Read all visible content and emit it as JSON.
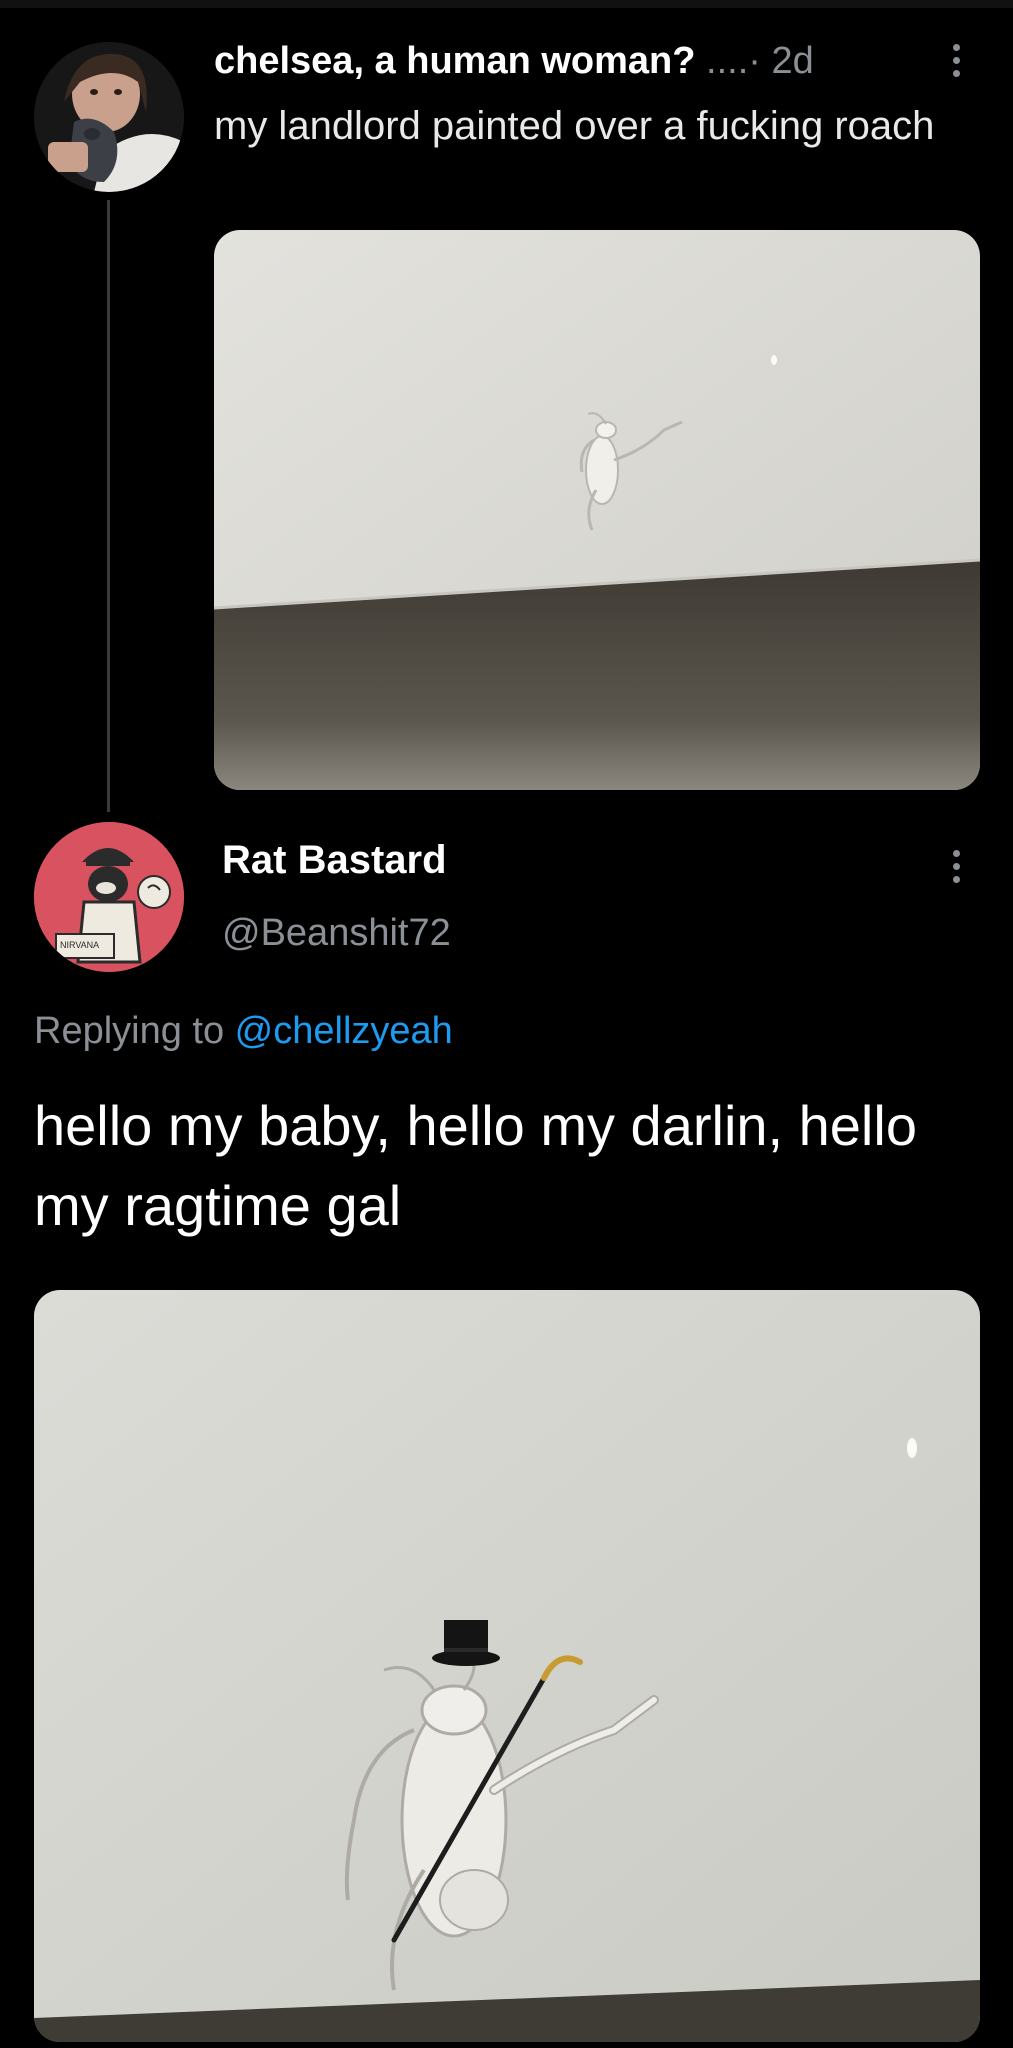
{
  "tweet1": {
    "display_name": "chelsea, a human woman?",
    "meta": " ....· 2d",
    "text": "my landlord painted over a fucking roach",
    "avatar_icon": "avatar-photo-icon",
    "more_icon": "more-options-icon"
  },
  "tweet2": {
    "display_name": "Rat Bastard",
    "handle": "@Beanshit72",
    "replying_prefix": "Replying to ",
    "replying_to": "@chellzyeah",
    "text": "hello my baby, hello my darlin, hello my ragtime gal",
    "avatar_sign": "NIRVANA",
    "more_icon": "more-options-icon"
  },
  "colors": {
    "background": "#000000",
    "mention": "#1d9bf0",
    "secondary_text": "#8b9096",
    "wall": "#d9d8d2"
  }
}
